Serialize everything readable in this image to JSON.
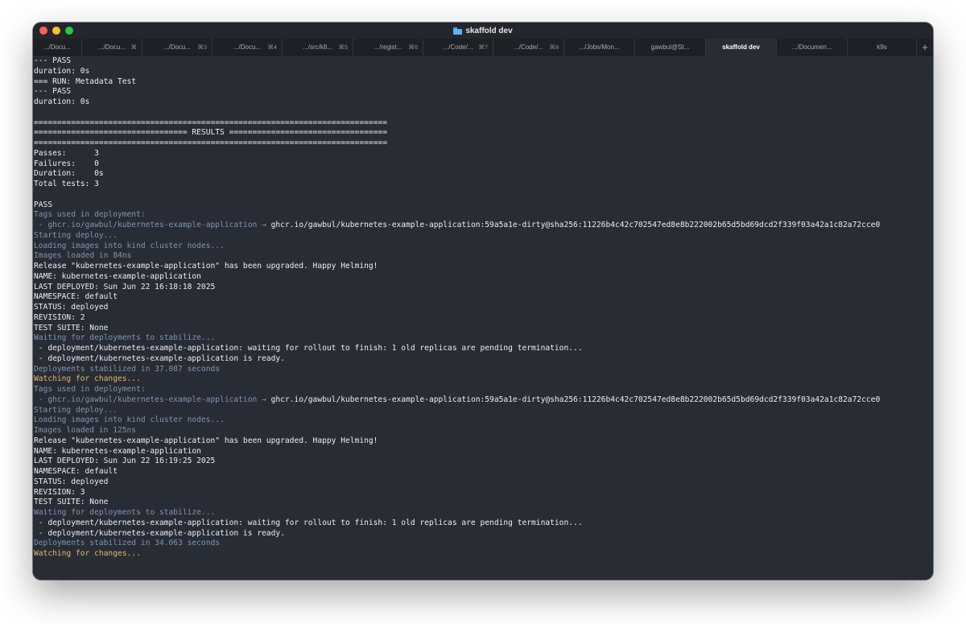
{
  "window": {
    "title": "skaffold dev"
  },
  "tabs": [
    {
      "label": ".../Docu...",
      "shortcut": "",
      "active": false
    },
    {
      "label": ".../Docu...",
      "shortcut": "⌘",
      "active": false
    },
    {
      "label": ".../Docu...",
      "shortcut": "⌘3",
      "active": false
    },
    {
      "label": ".../Docu...",
      "shortcut": "⌘4",
      "active": false
    },
    {
      "label": ".../src/k8...",
      "shortcut": "⌘5",
      "active": false
    },
    {
      "label": ".../regist...",
      "shortcut": "⌘6",
      "active": false
    },
    {
      "label": ".../Code/...",
      "shortcut": "⌘7",
      "active": false
    },
    {
      "label": ".../Code/...",
      "shortcut": "⌘8",
      "active": false
    },
    {
      "label": ".../Jobs/Mon...",
      "shortcut": "",
      "active": false
    },
    {
      "label": "gawbul@St...",
      "shortcut": "",
      "active": false
    },
    {
      "label": "skaffold dev",
      "shortcut": "",
      "active": true
    },
    {
      "label": ".../Documen...",
      "shortcut": "",
      "active": false
    },
    {
      "label": "k9s",
      "shortcut": "",
      "active": false
    }
  ],
  "tab_add_label": "+",
  "terminal": {
    "lines": [
      {
        "text": "--- PASS",
        "style": "normal"
      },
      {
        "text": "duration: 0s",
        "style": "normal"
      },
      {
        "text": "=== RUN: Metadata Test",
        "style": "normal"
      },
      {
        "text": "--- PASS",
        "style": "normal"
      },
      {
        "text": "duration: 0s",
        "style": "normal"
      },
      {
        "text": "",
        "style": "normal"
      },
      {
        "text": "============================================================================",
        "style": "normal"
      },
      {
        "text": "================================= RESULTS ==================================",
        "style": "normal"
      },
      {
        "text": "============================================================================",
        "style": "normal"
      },
      {
        "text": "Passes:      3",
        "style": "normal"
      },
      {
        "text": "Failures:    0",
        "style": "normal"
      },
      {
        "text": "Duration:    0s",
        "style": "normal"
      },
      {
        "text": "Total tests: 3",
        "style": "normal"
      },
      {
        "text": "",
        "style": "normal"
      },
      {
        "text": "PASS",
        "style": "normal"
      },
      {
        "text": "Tags used in deployment:",
        "style": "dim"
      },
      {
        "segments": [
          {
            "text": " - ghcr.io/gawbul/kubernetes-example-application → ",
            "style": "dim"
          },
          {
            "text": "ghcr.io/gawbul/kubernetes-example-application:59a5a1e-dirty@sha256:11226b4c42c702547ed8e8b222002b65d5bd69dcd2f339f03a42a1c82a72cce0",
            "style": "hi"
          }
        ]
      },
      {
        "text": "Starting deploy...",
        "style": "dim"
      },
      {
        "text": "Loading images into kind cluster nodes...",
        "style": "dim"
      },
      {
        "text": "Images loaded in 84ns",
        "style": "dim"
      },
      {
        "text": "Release \"kubernetes-example-application\" has been upgraded. Happy Helming!",
        "style": "normal"
      },
      {
        "text": "NAME: kubernetes-example-application",
        "style": "normal"
      },
      {
        "text": "LAST DEPLOYED: Sun Jun 22 16:18:18 2025",
        "style": "normal"
      },
      {
        "text": "NAMESPACE: default",
        "style": "normal"
      },
      {
        "text": "STATUS: deployed",
        "style": "normal"
      },
      {
        "text": "REVISION: 2",
        "style": "normal"
      },
      {
        "text": "TEST SUITE: None",
        "style": "normal"
      },
      {
        "text": "Waiting for deployments to stabilize...",
        "style": "dim"
      },
      {
        "text": " - deployment/kubernetes-example-application: waiting for rollout to finish: 1 old replicas are pending termination...",
        "style": "normal"
      },
      {
        "text": " - deployment/kubernetes-example-application is ready.",
        "style": "normal"
      },
      {
        "text": "Deployments stabilized in 37.087 seconds",
        "style": "dim"
      },
      {
        "text": "Watching for changes...",
        "style": "warn"
      },
      {
        "text": "Tags used in deployment:",
        "style": "dim"
      },
      {
        "segments": [
          {
            "text": " - ghcr.io/gawbul/kubernetes-example-application → ",
            "style": "dim"
          },
          {
            "text": "ghcr.io/gawbul/kubernetes-example-application:59a5a1e-dirty@sha256:11226b4c42c702547ed8e8b222002b65d5bd69dcd2f339f03a42a1c82a72cce0",
            "style": "hi"
          }
        ]
      },
      {
        "text": "Starting deploy...",
        "style": "dim"
      },
      {
        "text": "Loading images into kind cluster nodes...",
        "style": "dim"
      },
      {
        "text": "Images loaded in 125ns",
        "style": "dim"
      },
      {
        "text": "Release \"kubernetes-example-application\" has been upgraded. Happy Helming!",
        "style": "normal"
      },
      {
        "text": "NAME: kubernetes-example-application",
        "style": "normal"
      },
      {
        "text": "LAST DEPLOYED: Sun Jun 22 16:19:25 2025",
        "style": "normal"
      },
      {
        "text": "NAMESPACE: default",
        "style": "normal"
      },
      {
        "text": "STATUS: deployed",
        "style": "normal"
      },
      {
        "text": "REVISION: 3",
        "style": "normal"
      },
      {
        "text": "TEST SUITE: None",
        "style": "normal"
      },
      {
        "text": "Waiting for deployments to stabilize...",
        "style": "dim"
      },
      {
        "text": " - deployment/kubernetes-example-application: waiting for rollout to finish: 1 old replicas are pending termination...",
        "style": "normal"
      },
      {
        "text": " - deployment/kubernetes-example-application is ready.",
        "style": "normal"
      },
      {
        "text": "Deployments stabilized in 34.063 seconds",
        "style": "dim"
      },
      {
        "text": "Watching for changes...",
        "style": "warn"
      }
    ]
  },
  "colors": {
    "background": "#282c34",
    "text": "#eceff4",
    "dim_text": "#7f95b5",
    "warn_text": "#e5b86a"
  }
}
